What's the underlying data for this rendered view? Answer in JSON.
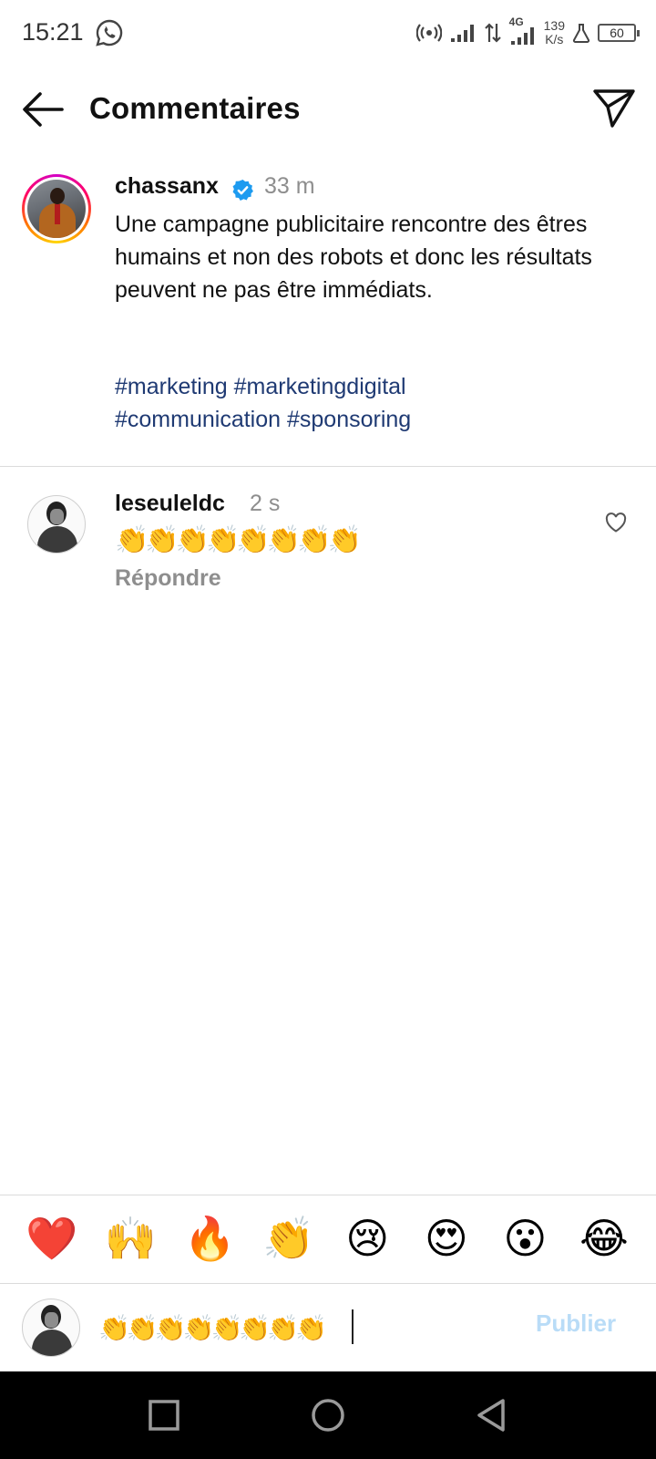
{
  "status_bar": {
    "time": "15:21",
    "network_type": "4G",
    "speed_value": "139",
    "speed_unit": "K/s",
    "battery": "60",
    "icons": [
      "whatsapp-icon",
      "hotspot-icon",
      "signal-icon",
      "data-transfer-icon",
      "signal-4g-icon",
      "lab-icon",
      "battery-icon"
    ]
  },
  "header": {
    "title": "Commentaires",
    "back_icon": "arrow-left-icon",
    "share_icon": "paper-plane-icon"
  },
  "caption": {
    "username": "chassanx",
    "verified": true,
    "time": "33 m",
    "text": "Une campagne publicitaire rencontre des êtres humains et non des robots et donc les résultats peuvent ne pas être immédiats.",
    "hashtags": [
      "#marketing",
      "#marketingdigital",
      "#communication",
      "#sponsoring"
    ]
  },
  "comments": [
    {
      "username": "leseuleldc",
      "time": "2 s",
      "text": "👏👏👏👏👏👏👏👏",
      "reply_label": "Répondre",
      "like_icon": "heart-outline-icon"
    }
  ],
  "reaction_bar": {
    "emojis": [
      "❤️",
      "🙌",
      "🔥",
      "👏",
      "😢",
      "😍",
      "😮",
      "😂"
    ]
  },
  "composer": {
    "value": "👏👏👏👏👏👏👏👏",
    "publish_label": "Publier",
    "publish_color": "#b9dcf7"
  },
  "nav_bar": {
    "buttons": [
      "recent-apps-icon",
      "home-icon",
      "back-icon"
    ]
  },
  "colors": {
    "hashtag": "#1f3a73",
    "secondary_text": "#8e8e8e",
    "verified": "#1d9bf0",
    "divider": "#dbdbdb"
  }
}
